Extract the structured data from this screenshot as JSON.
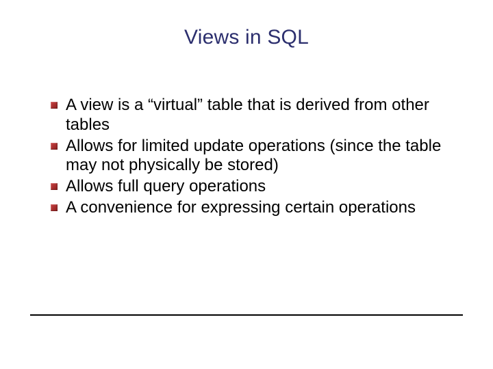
{
  "slide": {
    "title": "Views in SQL",
    "bullets": [
      "A view is a “virtual” table that is derived from other tables",
      "Allows for limited update operations (since the table may not physically be stored)",
      "Allows full query operations",
      "A convenience for expressing certain operations"
    ]
  },
  "colors": {
    "title": "#2c2f6e",
    "bullet": "#a62c2c"
  }
}
